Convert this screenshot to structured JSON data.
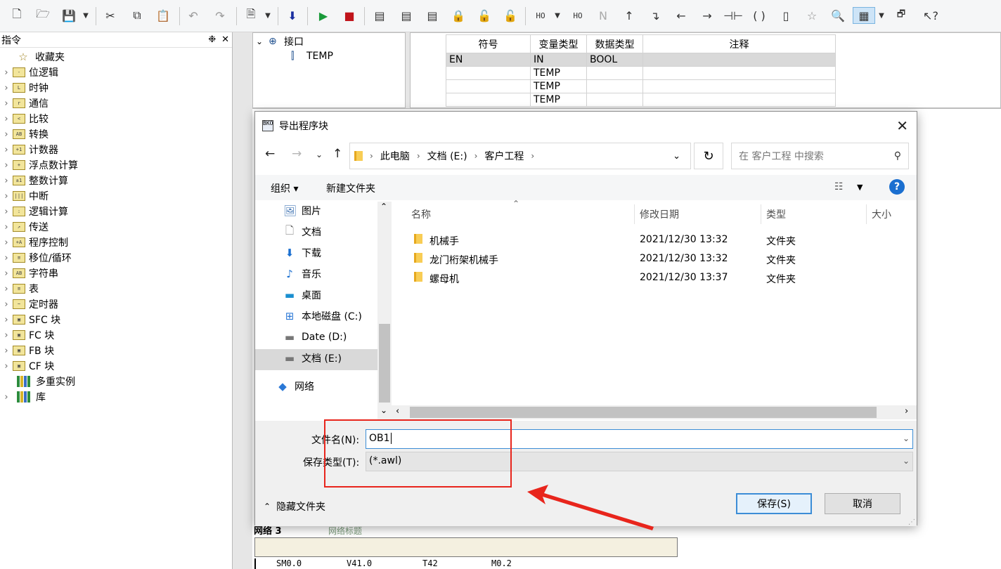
{
  "left_panel": {
    "title": "指令",
    "pin_icon": "❉",
    "close_icon": "✕",
    "items": [
      {
        "label": "收藏夹",
        "icon": "star-icon",
        "glyph": ""
      },
      {
        "label": "位逻辑",
        "icon": "folder-icon",
        "glyph": "-"
      },
      {
        "label": "时钟",
        "icon": "folder-icon",
        "glyph": "L"
      },
      {
        "label": "通信",
        "icon": "folder-icon",
        "glyph": "r"
      },
      {
        "label": "比较",
        "icon": "folder-icon",
        "glyph": "<"
      },
      {
        "label": "转换",
        "icon": "folder-icon",
        "glyph": "AB"
      },
      {
        "label": "计数器",
        "icon": "folder-icon",
        "glyph": "+1"
      },
      {
        "label": "浮点数计算",
        "icon": "folder-icon",
        "glyph": "+"
      },
      {
        "label": "整数计算",
        "icon": "folder-icon",
        "glyph": "±1"
      },
      {
        "label": "中断",
        "icon": "folder-icon",
        "glyph": "|||"
      },
      {
        "label": "逻辑计算",
        "icon": "folder-icon",
        "glyph": ":"
      },
      {
        "label": "传送",
        "icon": "folder-icon",
        "glyph": "↗"
      },
      {
        "label": "程序控制",
        "icon": "folder-icon",
        "glyph": "+A"
      },
      {
        "label": "移位/循环",
        "icon": "folder-icon",
        "glyph": "≡"
      },
      {
        "label": "字符串",
        "icon": "folder-icon",
        "glyph": "AB"
      },
      {
        "label": "表",
        "icon": "folder-icon",
        "glyph": "≡"
      },
      {
        "label": "定时器",
        "icon": "folder-icon",
        "glyph": "~"
      },
      {
        "label": "SFC 块",
        "icon": "folder-icon",
        "glyph": "▣"
      },
      {
        "label": "FC 块",
        "icon": "folder-icon",
        "glyph": "▣"
      },
      {
        "label": "FB 块",
        "icon": "folder-icon",
        "glyph": "▣"
      },
      {
        "label": "CF 块",
        "icon": "folder-icon",
        "glyph": "▣"
      },
      {
        "label": "多重实例",
        "icon": "library-icon",
        "glyph": ""
      },
      {
        "label": "库",
        "icon": "library-icon",
        "glyph": ""
      }
    ]
  },
  "interface": {
    "root_label": "接口",
    "child_label": "TEMP",
    "headers": [
      "符号",
      "变量类型",
      "数据类型",
      "注释"
    ],
    "rows": [
      [
        "EN",
        "IN",
        "BOOL",
        ""
      ],
      [
        "",
        "TEMP",
        "",
        ""
      ],
      [
        "",
        "TEMP",
        "",
        ""
      ],
      [
        "",
        "TEMP",
        "",
        ""
      ]
    ]
  },
  "program": {
    "network_title": "网络 3",
    "network_comment": "网络标题",
    "contacts": [
      "SM0.0",
      "V41.0",
      "T42",
      "M0.2"
    ]
  },
  "dialog": {
    "title": "导出程序块",
    "title_icon_text": "BKO",
    "breadcrumb": [
      "此电脑",
      "文档 (E:)",
      "客户工程"
    ],
    "search_placeholder": "在 客户工程 中搜索",
    "organize": "组织 ▾",
    "new_folder": "新建文件夹",
    "help": "?",
    "nav_items": [
      {
        "label": "图片",
        "icon": "pictures-icon",
        "glyph": "🖼"
      },
      {
        "label": "文档",
        "icon": "documents-icon",
        "glyph": "🗋"
      },
      {
        "label": "下载",
        "icon": "downloads-icon",
        "glyph": "⬇"
      },
      {
        "label": "音乐",
        "icon": "music-icon",
        "glyph": "♪"
      },
      {
        "label": "桌面",
        "icon": "desktop-icon",
        "glyph": "▬"
      },
      {
        "label": "本地磁盘 (C:)",
        "icon": "drive-c-icon",
        "glyph": "⊞"
      },
      {
        "label": "Date (D:)",
        "icon": "drive-icon",
        "glyph": "▬"
      },
      {
        "label": "文档 (E:)",
        "icon": "drive-icon",
        "glyph": "▬"
      },
      {
        "label": "网络",
        "icon": "network-icon",
        "glyph": "◆"
      }
    ],
    "columns": [
      "名称",
      "修改日期",
      "类型",
      "大小"
    ],
    "files": [
      {
        "name": "机械手",
        "date": "2021/12/30 13:32",
        "type": "文件夹"
      },
      {
        "name": "龙门桁架机械手",
        "date": "2021/12/30 13:32",
        "type": "文件夹"
      },
      {
        "name": "螺母机",
        "date": "2021/12/30 13:37",
        "type": "文件夹"
      }
    ],
    "filename_label": "文件名(N):",
    "filename_value": "OB1",
    "filetype_label": "保存类型(T):",
    "filetype_value": "(*.awl)",
    "hide_folders": "隐藏文件夹",
    "save": "保存(S)",
    "cancel": "取消"
  },
  "annotation": {
    "box_color": "#e8251c",
    "arrow_color": "#e8251c"
  }
}
